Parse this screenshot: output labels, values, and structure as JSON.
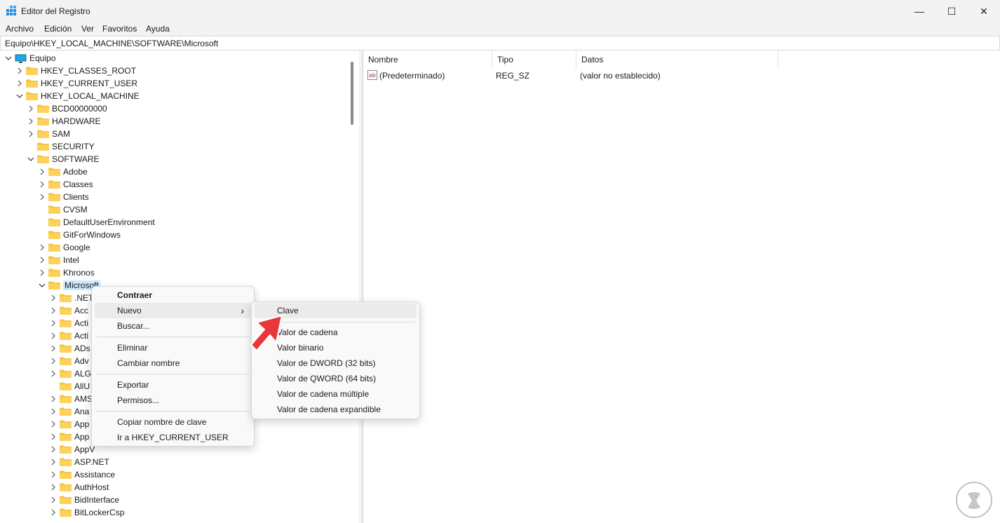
{
  "window": {
    "title": "Editor del Registro",
    "min_label": "—",
    "max_label": "☐",
    "close_label": "✕"
  },
  "menu": [
    "Archivo",
    "Edición",
    "Ver",
    "Favoritos",
    "Ayuda"
  ],
  "address": "Equipo\\HKEY_LOCAL_MACHINE\\SOFTWARE\\Microsoft",
  "tree": {
    "root": "Equipo",
    "hives": [
      "HKEY_CLASSES_ROOT",
      "HKEY_CURRENT_USER",
      "HKEY_LOCAL_MACHINE"
    ],
    "hklm": [
      "BCD00000000",
      "HARDWARE",
      "SAM",
      "SECURITY",
      "SOFTWARE"
    ],
    "software": [
      "Adobe",
      "Classes",
      "Clients",
      "CVSM",
      "DefaultUserEnvironment",
      "GitForWindows",
      "Google",
      "Intel",
      "Khronos",
      "Microsoft"
    ],
    "microsoft_visible": [
      ".NET",
      "Acc",
      "Acti",
      "Acti",
      "ADs",
      "Adv",
      "ALG",
      "AllU",
      "AMS",
      "Ana",
      "App",
      "App",
      "AppV",
      "ASP.NET",
      "Assistance",
      "AuthHost",
      "BidInterface",
      "BitLockerCsp"
    ]
  },
  "list": {
    "headers": [
      "Nombre",
      "Tipo",
      "Datos"
    ],
    "rows": [
      {
        "name": "(Predeterminado)",
        "type": "REG_SZ",
        "data": "(valor no establecido)"
      }
    ]
  },
  "context_menu": {
    "items": [
      "Contraer",
      "Nuevo",
      "Buscar...",
      "Eliminar",
      "Cambiar nombre",
      "Exportar",
      "Permisos...",
      "Copiar nombre de clave",
      "Ir a HKEY_CURRENT_USER"
    ],
    "submenu_arrow": "›"
  },
  "submenu": {
    "items": [
      "Clave",
      "Valor de cadena",
      "Valor binario",
      "Valor de DWORD (32 bits)",
      "Valor de QWORD (64 bits)",
      "Valor de cadena múltiple",
      "Valor de cadena expandible"
    ]
  },
  "colors": {
    "selection": "#cce8ff",
    "folder": "#f8c33c",
    "arrow": "#e8363a"
  }
}
